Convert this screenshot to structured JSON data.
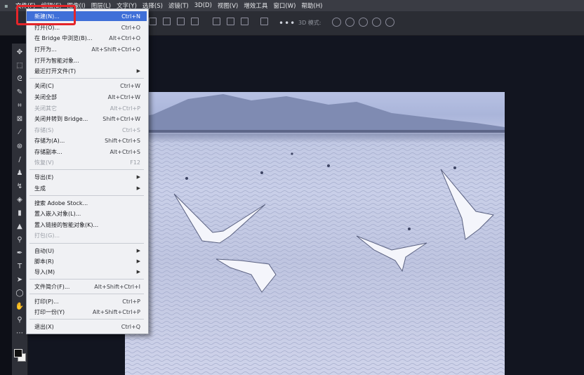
{
  "menubar": {
    "items": [
      "文件(F)",
      "编辑(E)",
      "图像(I)",
      "图层(L)",
      "文字(Y)",
      "选择(S)",
      "滤镜(T)",
      "3D(D)",
      "视图(V)",
      "增效工具",
      "窗口(W)",
      "帮助(H)"
    ]
  },
  "optionsbar": {
    "more": "•••",
    "mode_label": "3D 模式:"
  },
  "file_menu": {
    "items": [
      {
        "label": "新建(N)...",
        "shortcut": "Ctrl+N",
        "state": "highlight"
      },
      {
        "label": "打开(O)...",
        "shortcut": "Ctrl+O"
      },
      {
        "label": "在 Bridge 中浏览(B)...",
        "shortcut": "Alt+Ctrl+O"
      },
      {
        "label": "打开为...",
        "shortcut": "Alt+Shift+Ctrl+O"
      },
      {
        "label": "打开为智能对象...",
        "shortcut": ""
      },
      {
        "label": "最近打开文件(T)",
        "shortcut": "",
        "submenu": true
      },
      {
        "label": "关闭(C)",
        "shortcut": "Ctrl+W"
      },
      {
        "label": "关闭全部",
        "shortcut": "Alt+Ctrl+W"
      },
      {
        "label": "关闭其它",
        "shortcut": "Alt+Ctrl+P",
        "state": "disabled"
      },
      {
        "label": "关闭并转到 Bridge...",
        "shortcut": "Shift+Ctrl+W"
      },
      {
        "label": "存储(S)",
        "shortcut": "Ctrl+S",
        "state": "disabled"
      },
      {
        "label": "存储为(A)...",
        "shortcut": "Shift+Ctrl+S"
      },
      {
        "label": "存储副本...",
        "shortcut": "Alt+Ctrl+S"
      },
      {
        "label": "恢复(V)",
        "shortcut": "F12",
        "state": "disabled"
      },
      {
        "label": "导出(E)",
        "shortcut": "",
        "submenu": true
      },
      {
        "label": "生成",
        "shortcut": "",
        "submenu": true
      },
      {
        "label": "搜索 Adobe Stock...",
        "shortcut": ""
      },
      {
        "label": "置入嵌入对象(L)...",
        "shortcut": ""
      },
      {
        "label": "置入链接的智能对象(K)...",
        "shortcut": ""
      },
      {
        "label": "打包(G)...",
        "shortcut": "",
        "state": "disabled"
      },
      {
        "label": "自动(U)",
        "shortcut": "",
        "submenu": true
      },
      {
        "label": "脚本(R)",
        "shortcut": "",
        "submenu": true
      },
      {
        "label": "导入(M)",
        "shortcut": "",
        "submenu": true
      },
      {
        "label": "文件简介(F)...",
        "shortcut": "Alt+Shift+Ctrl+I"
      },
      {
        "label": "打印(P)...",
        "shortcut": "Ctrl+P"
      },
      {
        "label": "打印一份(Y)",
        "shortcut": "Alt+Shift+Ctrl+P"
      },
      {
        "label": "退出(X)",
        "shortcut": "Ctrl+Q"
      }
    ]
  },
  "colors": {
    "highlight": "#3f6fd8",
    "annotation": "#e5252a"
  }
}
